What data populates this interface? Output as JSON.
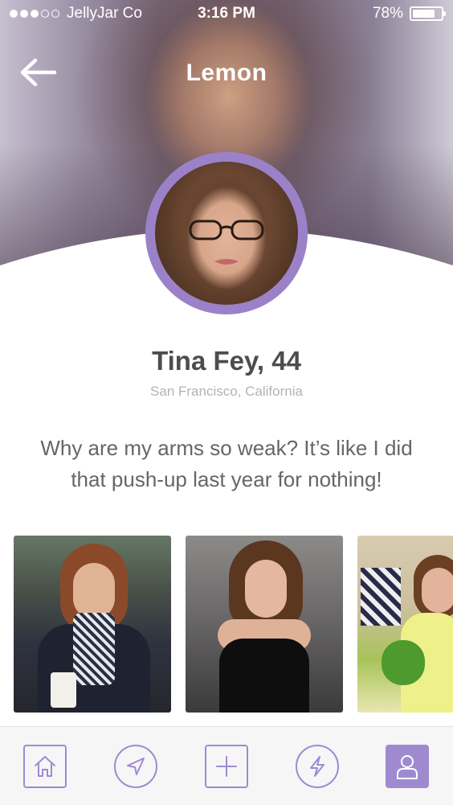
{
  "status_bar": {
    "carrier": "JellyJar Co",
    "time": "3:16 PM",
    "battery_percent": "78%",
    "battery_level": 0.78
  },
  "header": {
    "title": "Lemon",
    "back_icon": "arrow-left-icon"
  },
  "profile": {
    "name_age": "Tina Fey, 44",
    "location": "San Francisco, California",
    "bio": "Why are my arms so weak? It’s like I did that push-up last year for nothing!"
  },
  "gallery": {
    "photos": [
      "photo-1",
      "photo-2",
      "photo-3"
    ]
  },
  "tab_bar": {
    "items": [
      {
        "icon": "home-icon",
        "active": false
      },
      {
        "icon": "navigation-arrow-icon",
        "active": false
      },
      {
        "icon": "plus-icon",
        "active": false
      },
      {
        "icon": "lightning-bolt-icon",
        "active": false
      },
      {
        "icon": "user-icon",
        "active": true
      }
    ]
  },
  "colors": {
    "accent": "#9b82c8",
    "tab_accent": "#9f8ad0",
    "name_text": "#4d4d4d",
    "location_text": "#b3b3b3",
    "bio_text": "#666666"
  }
}
